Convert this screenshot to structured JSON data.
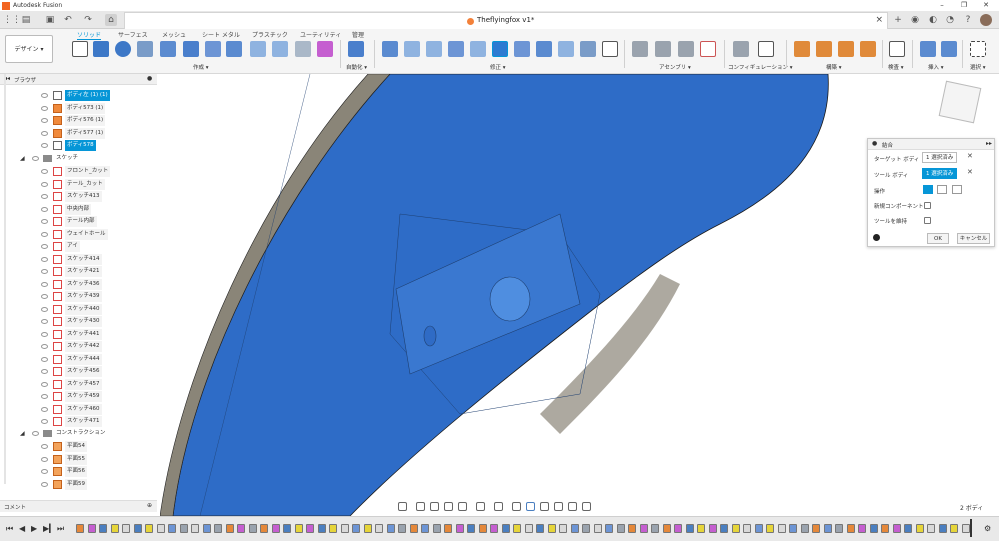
{
  "window": {
    "app_title": "Autodesk Fusion",
    "doc_title": "Theflyingfox v1*"
  },
  "colors": {
    "accent": "#0696d7",
    "body_blue": "#2e6cc7",
    "shell_tan": "#8a8578"
  },
  "ribbon": {
    "design_label": "デザイン ▾",
    "tabs": [
      "ソリッド",
      "サーフェス",
      "メッシュ",
      "シート メタル",
      "プラスチック",
      "ユーティリティ",
      "管理"
    ],
    "groups": [
      "作成 ▾",
      "自動化 ▾",
      "修正 ▾",
      "アセンブリ ▾",
      "コンフィギュレーション ▾",
      "構築 ▾",
      "検査 ▾",
      "挿入 ▾",
      "選択 ▾"
    ]
  },
  "browser": {
    "title": "ブラウザ",
    "bodies": [
      {
        "label": "ボディ左 (1) (1)",
        "selected": true
      },
      {
        "label": "ボディ573 (1)",
        "selected": false
      },
      {
        "label": "ボディ576 (1)",
        "selected": false
      },
      {
        "label": "ボディ577 (1)",
        "selected": false
      },
      {
        "label": "ボディ578",
        "selected": true
      }
    ],
    "sketch_folder": "スケッチ",
    "sketches": [
      "フロント_カット",
      "テール_カット",
      "スケッチ413",
      "中央内部",
      "テール内部",
      "ウェイトホール",
      "アイ",
      "スケッチ414",
      "スケッチ421",
      "スケッチ436",
      "スケッチ439",
      "スケッチ440",
      "スケッチ430",
      "スケッチ441",
      "スケッチ442",
      "スケッチ444",
      "スケッチ456",
      "スケッチ457",
      "スケッチ459",
      "スケッチ460",
      "スケッチ471"
    ],
    "construction_folder": "コンストラクション",
    "planes": [
      "平面54",
      "平面55",
      "平面56",
      "平面59"
    ]
  },
  "comments": {
    "label": "コメント"
  },
  "dialog": {
    "title": "結合",
    "target_label": "ターゲット ボディ",
    "target_value": "1 選択済み",
    "tool_label": "ツール ボディ",
    "tool_value": "1 選択済み",
    "operation_label": "操作",
    "new_component_label": "新規コンポーネント",
    "keep_tools_label": "ツールを維持",
    "ok": "OK",
    "cancel": "キャンセル"
  },
  "status": {
    "body_count": "2 ボディ"
  }
}
